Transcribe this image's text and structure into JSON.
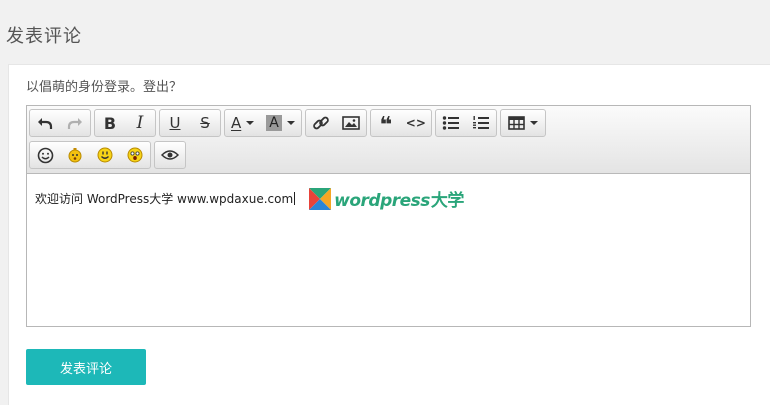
{
  "page": {
    "title": "发表评论"
  },
  "login": {
    "prefix": "以",
    "user": "倡萌",
    "middle": "的身份登录。",
    "logout": "登出？"
  },
  "toolbar": {
    "font_color_glyph": "A",
    "bg_color_glyph": "A",
    "bold_glyph": "B",
    "italic_glyph": "I",
    "underline_glyph": "U",
    "strike_glyph": "S",
    "quote_glyph": "❝",
    "code_glyph": "<>"
  },
  "editor": {
    "content": "欢迎访问 WordPress大学 www.wpdaxue.com"
  },
  "logo": {
    "text": "wordpress",
    "suffix": "大学"
  },
  "submit": {
    "label": "发表评论"
  },
  "colors": {
    "accent": "#1db8b8",
    "logo": "#2aa57a"
  }
}
